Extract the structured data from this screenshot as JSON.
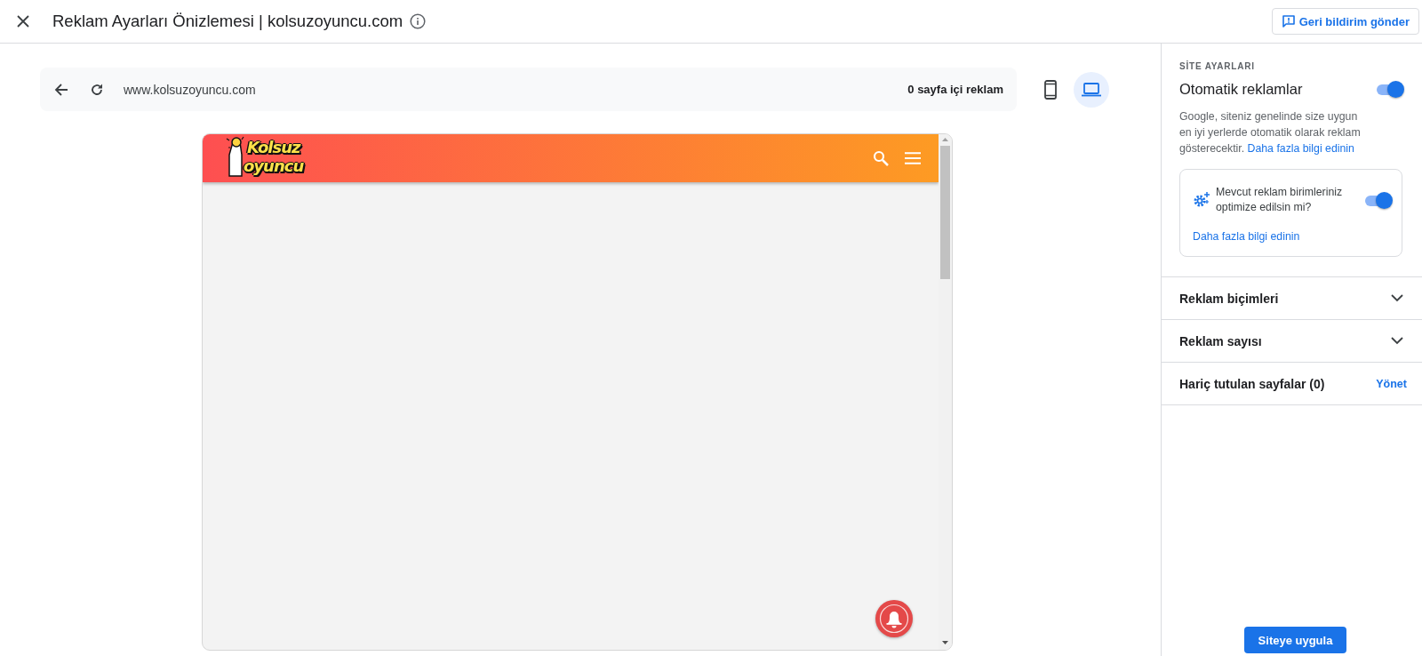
{
  "header": {
    "title": "Reklam Ayarları Önizlemesi | kolsuzoyuncu.com",
    "feedback_button": "Geri bildirim gönder"
  },
  "browser_bar": {
    "url": "www.kolsuzoyuncu.com",
    "ad_count": "0 sayfa içi reklam"
  },
  "devices": [
    {
      "kind": "mobile",
      "selected": false
    },
    {
      "kind": "desktop",
      "selected": true
    }
  ],
  "site": {
    "logo_lines": [
      "Kolsuz",
      "oyuncu"
    ]
  },
  "panel": {
    "section_title": "SİTE AYARLARI",
    "auto_ads": {
      "label": "Otomatik reklamlar",
      "on": true,
      "description": "Google, siteniz genelinde size uygun en iyi yerlerde otomatik olarak reklam gösterecektir.",
      "link": "Daha fazla bilgi edinin"
    },
    "optimize": {
      "label": "Mevcut reklam birimleriniz optimize edilsin mi?",
      "on": true,
      "link": "Daha fazla bilgi edinin"
    },
    "rows": [
      {
        "kind": "accordion",
        "label": "Reklam biçimleri",
        "expanded": false
      },
      {
        "kind": "accordion",
        "label": "Reklam sayısı",
        "expanded": false
      },
      {
        "kind": "action",
        "label": "Hariç tutulan sayfalar (0)",
        "action": "Yönet"
      }
    ],
    "apply_button": "Siteye uygula"
  }
}
